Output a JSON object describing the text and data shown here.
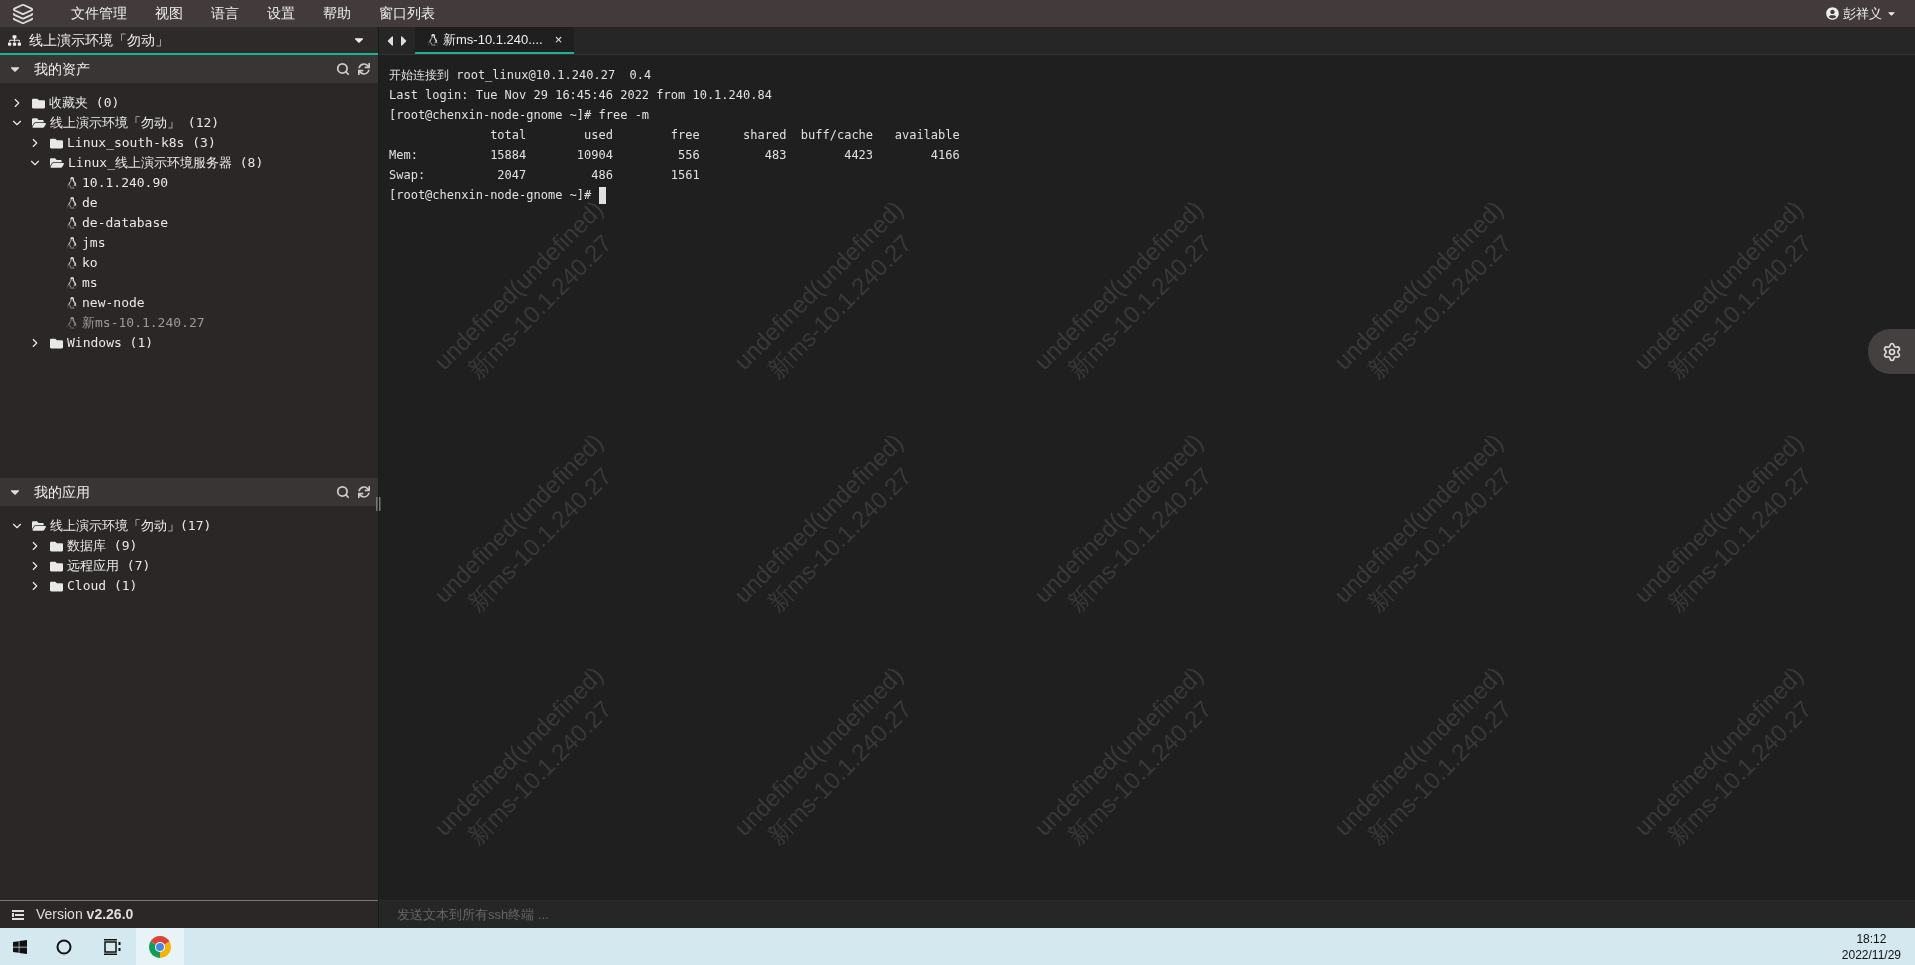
{
  "menu_bar": {
    "items": [
      "文件管理",
      "视图",
      "语言",
      "设置",
      "帮助",
      "窗口列表"
    ],
    "user": "彭祥义"
  },
  "sidebar": {
    "workspace": "线上演示环境「勿动」",
    "sections": [
      {
        "title": "我的资产",
        "expanded": true,
        "tree": [
          {
            "kind": "folder",
            "label": "收藏夹 (0)",
            "expanded": false
          },
          {
            "kind": "folder",
            "label": "线上演示环境「勿动」 (12)",
            "expanded": true,
            "children": [
              {
                "kind": "folder",
                "label": "Linux_south-k8s (3)",
                "expanded": false
              },
              {
                "kind": "folder",
                "label": "Linux_线上演示环境服务器 (8)",
                "expanded": true,
                "children": [
                  {
                    "kind": "host",
                    "label": "10.1.240.90",
                    "dimmed": false
                  },
                  {
                    "kind": "host",
                    "label": "de",
                    "dimmed": false
                  },
                  {
                    "kind": "host",
                    "label": "de-database",
                    "dimmed": false
                  },
                  {
                    "kind": "host",
                    "label": "jms",
                    "dimmed": false
                  },
                  {
                    "kind": "host",
                    "label": "ko",
                    "dimmed": false
                  },
                  {
                    "kind": "host",
                    "label": "ms",
                    "dimmed": false
                  },
                  {
                    "kind": "host",
                    "label": "new-node",
                    "dimmed": false
                  },
                  {
                    "kind": "host",
                    "label": "新ms-10.1.240.27",
                    "dimmed": true
                  }
                ]
              },
              {
                "kind": "folder",
                "label": "Windows (1)",
                "expanded": false
              }
            ]
          }
        ]
      },
      {
        "title": "我的应用",
        "expanded": true,
        "tree": [
          {
            "kind": "folder",
            "label": "线上演示环境「勿动」(17)",
            "expanded": true,
            "children": [
              {
                "kind": "folder",
                "label": "数据库 (9)",
                "expanded": false
              },
              {
                "kind": "folder",
                "label": "远程应用 (7)",
                "expanded": false
              },
              {
                "kind": "folder",
                "label": "Cloud (1)",
                "expanded": false
              }
            ]
          }
        ]
      }
    ],
    "version": "Version **v2.26.0**"
  },
  "tabs": [
    {
      "label": "新ms-10.1.240....",
      "selected": true,
      "close": "×"
    }
  ],
  "terminal": {
    "lines": [
      "开始连接到 root_linux@10.1.240.27  0.4",
      "Last login: Tue Nov 29 16:45:46 2022 from 10.1.240.84",
      "[root@chenxin-node-gnome ~]# free -m",
      "              total        used        free      shared  buff/cache   available",
      "Mem:          15884       10904         556         483        4423        4166",
      "Swap:          2047         486        1561",
      "[root@chenxin-node-gnome ~]# "
    ],
    "cursor": true
  },
  "watermarks": [
    {
      "line_1": "undefined(undefined)",
      "line_2": "新ms-10.1.240.27"
    },
    {
      "line_1": "undefined(undefined)",
      "line_2": "新ms-10.1.240.27"
    },
    {
      "line_1": "undefined(undefined)",
      "line_2": "新ms-10.1.240.27"
    },
    {
      "line_1": "undefined(undefined)",
      "line_2": "新ms-10.1.240.27"
    },
    {
      "line_1": "undefined(undefined)",
      "line_2": "新ms-10.1.240.27"
    },
    {
      "line_1": "undefined(undefined)",
      "line_2": "新ms-10.1.240.27"
    },
    {
      "line_1": "undefined(undefined)",
      "line_2": "新ms-10.1.240.27"
    },
    {
      "line_1": "undefined(undefined)",
      "line_2": "新ms-10.1.240.27"
    },
    {
      "line_1": "undefined(undefined)",
      "line_2": "新ms-10.1.240.27"
    },
    {
      "line_1": "undefined(undefined)",
      "line_2": "新ms-10.1.240.27"
    },
    {
      "line_1": "undefined(undefined)",
      "line_2": "新ms-10.1.240.27"
    },
    {
      "line_1": "undefined(undefined)",
      "line_2": "新ms-10.1.240.27"
    },
    {
      "line_1": "undefined(undefined)",
      "line_2": "新ms-10.1.240.27"
    },
    {
      "line_1": "undefined(undefined)",
      "line_2": "新ms-10.1.240.27"
    },
    {
      "line_1": "undefined(undefined)",
      "line_2": "新ms-10.1.240.27"
    }
  ],
  "broadcast_input": {
    "placeholder": "发送文本到所有ssh终端 ..."
  },
  "taskbar": {
    "time": "18:12",
    "date": "2022/11/29"
  }
}
